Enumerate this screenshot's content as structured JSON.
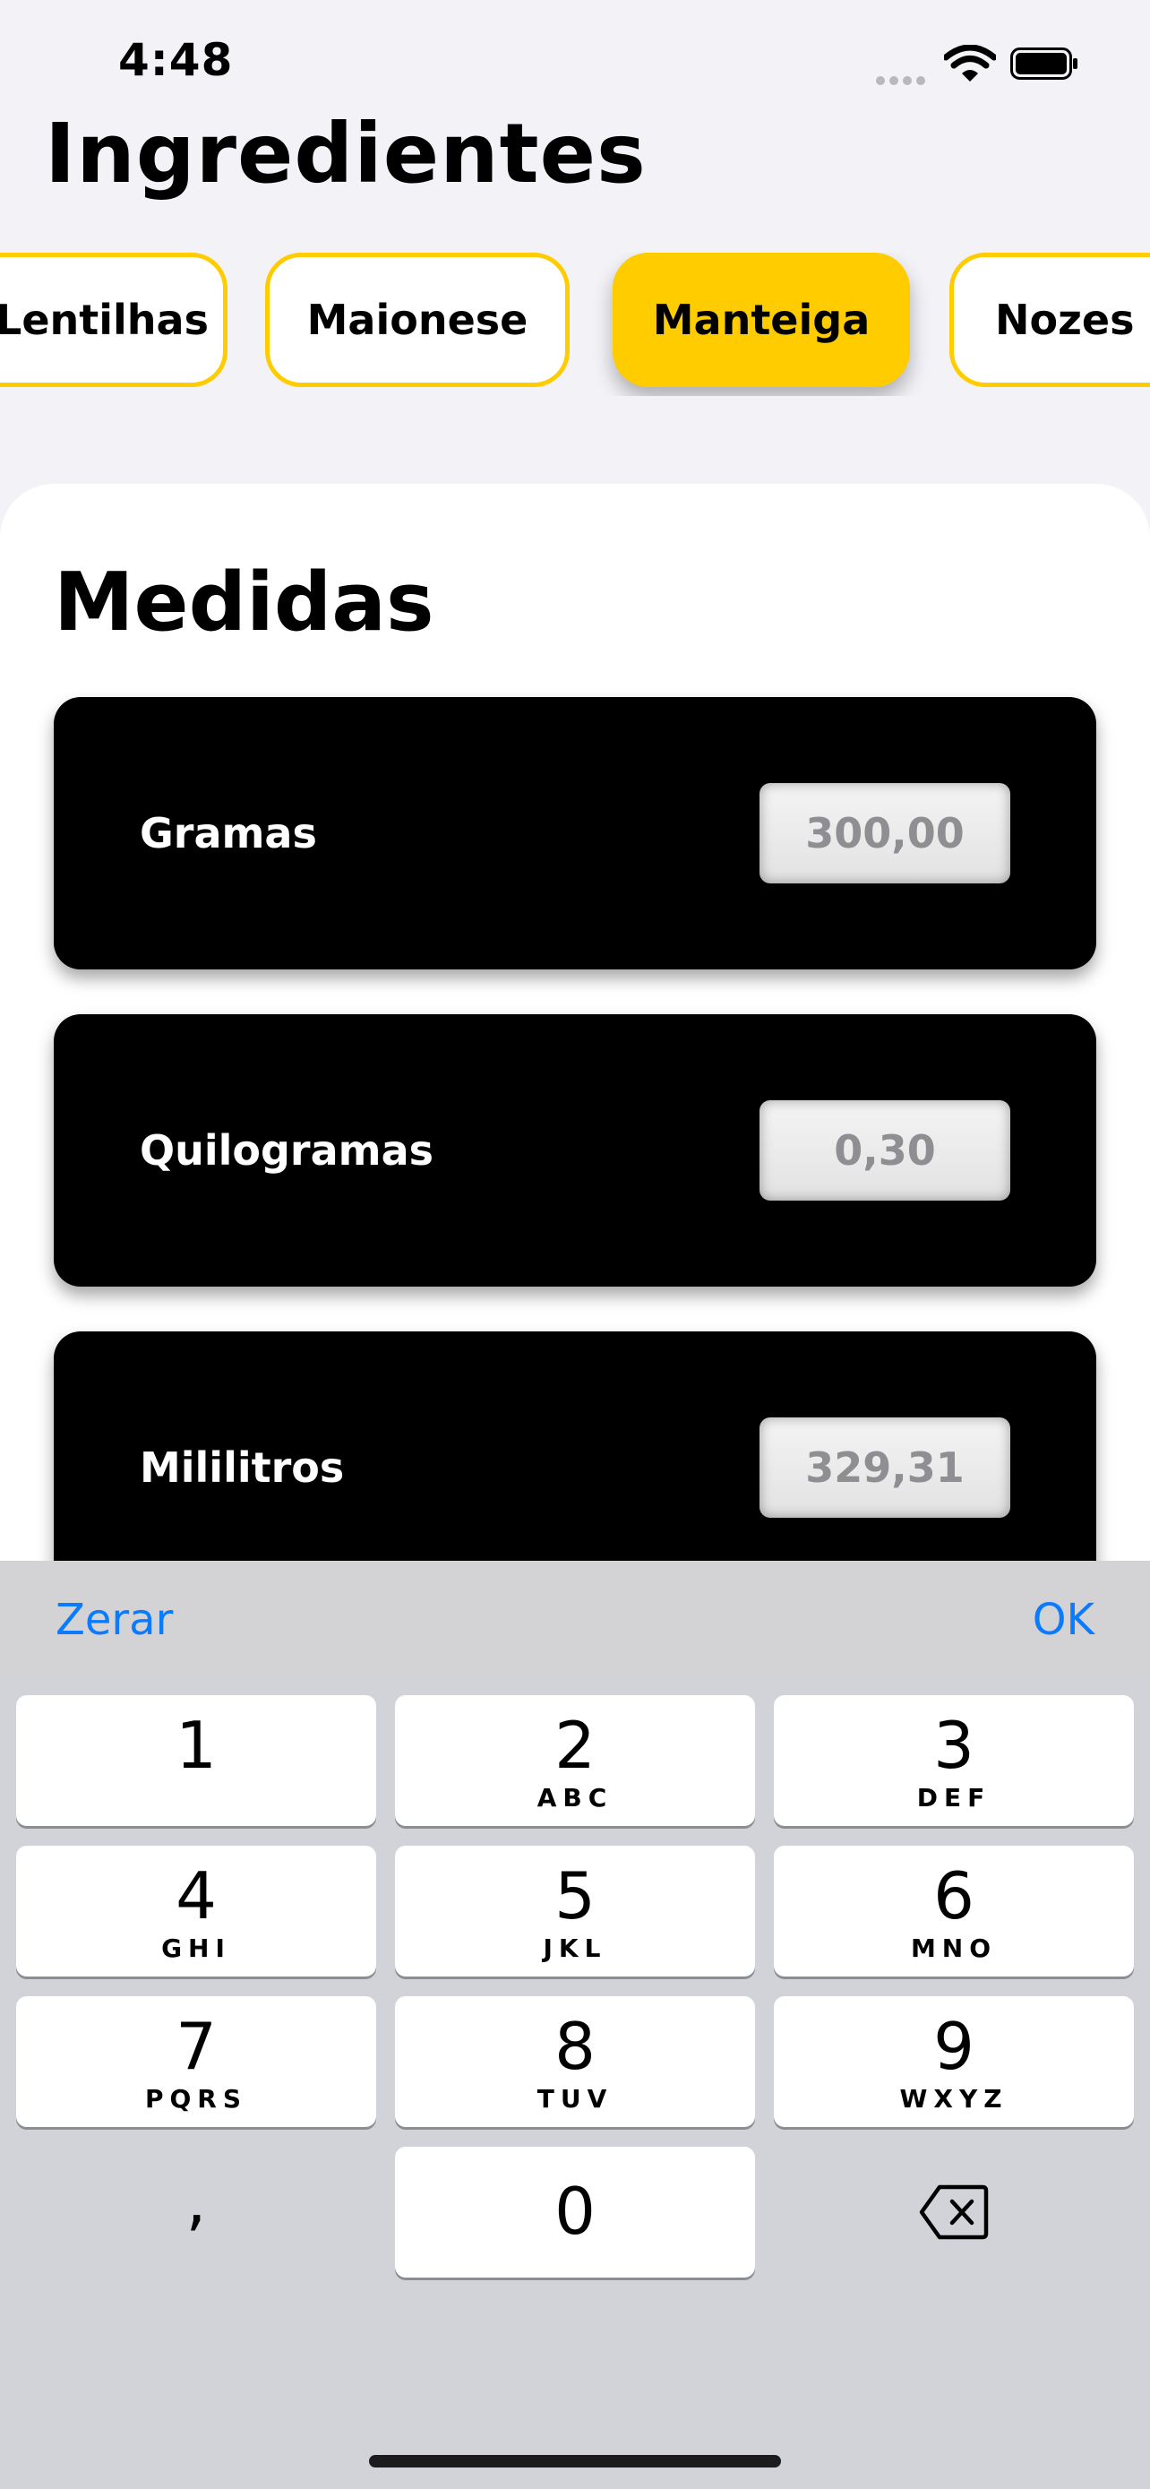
{
  "status_bar": {
    "time": "4:48"
  },
  "header": {
    "title": "Ingredientes"
  },
  "ingredients": {
    "items": [
      {
        "label": "Lentilhas",
        "selected": false
      },
      {
        "label": "Maionese",
        "selected": false
      },
      {
        "label": "Manteiga",
        "selected": true
      },
      {
        "label": "Nozes",
        "selected": false
      }
    ]
  },
  "measures": {
    "title": "Medidas",
    "items": [
      {
        "label": "Gramas",
        "value": "300,00"
      },
      {
        "label": "Quilogramas",
        "value": "0,30"
      },
      {
        "label": "Mililitros",
        "value": "329,31"
      }
    ]
  },
  "keyboard_toolbar": {
    "reset_label": "Zerar",
    "done_label": "OK"
  },
  "keypad": {
    "keys": [
      {
        "digit": "1",
        "letters": ""
      },
      {
        "digit": "2",
        "letters": "ABC"
      },
      {
        "digit": "3",
        "letters": "DEF"
      },
      {
        "digit": "4",
        "letters": "GHI"
      },
      {
        "digit": "5",
        "letters": "JKL"
      },
      {
        "digit": "6",
        "letters": "MNO"
      },
      {
        "digit": "7",
        "letters": "PQRS"
      },
      {
        "digit": "8",
        "letters": "TUV"
      },
      {
        "digit": "9",
        "letters": "WXYZ"
      }
    ],
    "decimal_separator": ",",
    "zero": "0"
  },
  "icons": {
    "wifi": "wifi-icon",
    "battery": "battery-icon",
    "backspace": "backspace-icon"
  },
  "colors": {
    "accent": "#ffcc00",
    "link": "#0a7aff",
    "card": "#000000"
  }
}
